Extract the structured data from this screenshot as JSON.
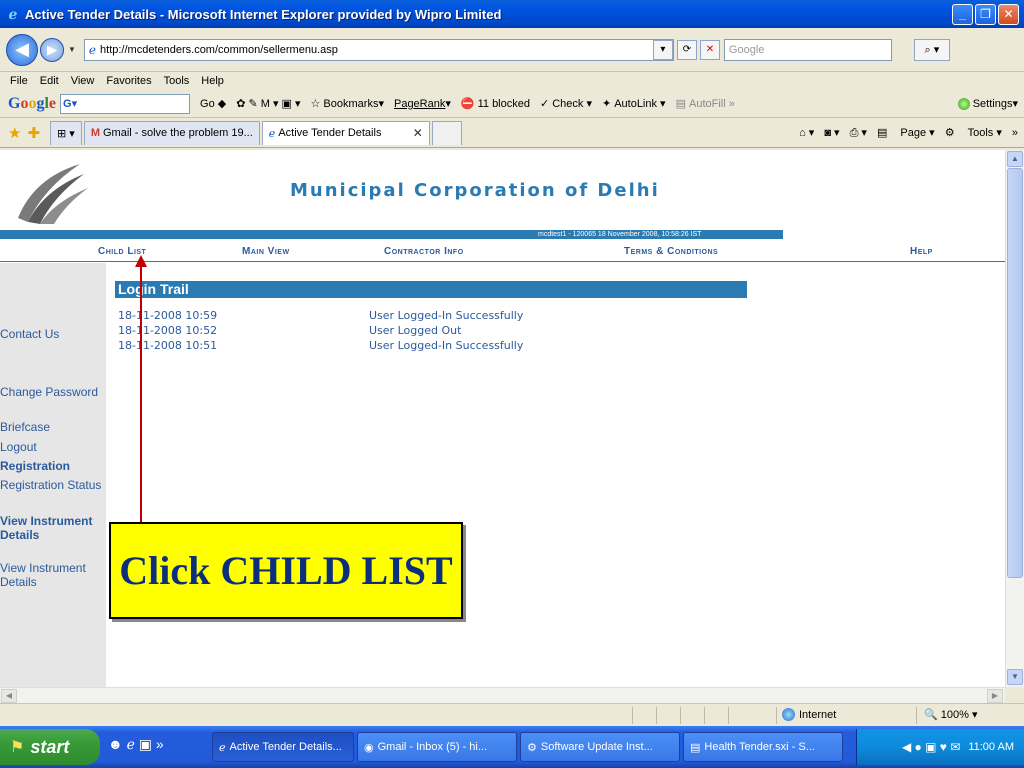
{
  "window": {
    "title": "Active Tender Details - Microsoft Internet Explorer provided by Wipro Limited"
  },
  "address": {
    "url": "http://mcdetenders.com/common/sellermenu.asp",
    "search_placeholder": "Google"
  },
  "menu": [
    "File",
    "Edit",
    "View",
    "Favorites",
    "Tools",
    "Help"
  ],
  "google_toolbar": {
    "go": "Go",
    "bookmarks": "Bookmarks",
    "pagerank": "PageRank",
    "blocked": "11 blocked",
    "check": "Check",
    "autolink": "AutoLink",
    "autofill": "AutoFill",
    "settings": "Settings"
  },
  "tabs": [
    {
      "label": "Gmail - solve the problem 19..."
    },
    {
      "label": "Active Tender Details"
    }
  ],
  "commands": {
    "page": "Page",
    "tools": "Tools"
  },
  "page": {
    "org_title": "Municipal Corporation of Delhi",
    "session": "mcdtest1 - 120065    18 November 2008, 10:58:26  IST",
    "nav": [
      "Child List",
      "Main View",
      "Contractor Info",
      "Terms & Conditions",
      "Help"
    ],
    "sidebar": [
      {
        "label": "Contact Us",
        "bold": false
      },
      {
        "label": "Change Password",
        "bold": false
      },
      {
        "label": "Briefcase",
        "bold": false
      },
      {
        "label": "Logout",
        "bold": false
      },
      {
        "label": "Registration",
        "bold": true
      },
      {
        "label": "Registration Status",
        "bold": false
      },
      {
        "label": "View Instrument Details",
        "bold": true
      },
      {
        "label": "View Instrument Details",
        "bold": false
      }
    ],
    "trail_title": "Login Trail",
    "trail": [
      {
        "time": "18-11-2008 10:59",
        "msg": "User Logged-In Successfully"
      },
      {
        "time": "18-11-2008 10:52",
        "msg": "User Logged Out"
      },
      {
        "time": "18-11-2008 10:51",
        "msg": "User Logged-In Successfully"
      }
    ],
    "callout": "Click CHILD LIST"
  },
  "status": {
    "zone": "Internet",
    "zoom": "100%"
  },
  "taskbar": {
    "start": "start",
    "tasks": [
      "Active Tender Details...",
      "Gmail - Inbox (5) - hi...",
      "Software Update Inst...",
      "Health Tender.sxi - S..."
    ],
    "clock": "11:00 AM"
  },
  "colors": {
    "accent": "#2b7bb3",
    "link": "#2b5a9c",
    "callout_bg": "#ffff00",
    "arrow": "#c00000"
  }
}
